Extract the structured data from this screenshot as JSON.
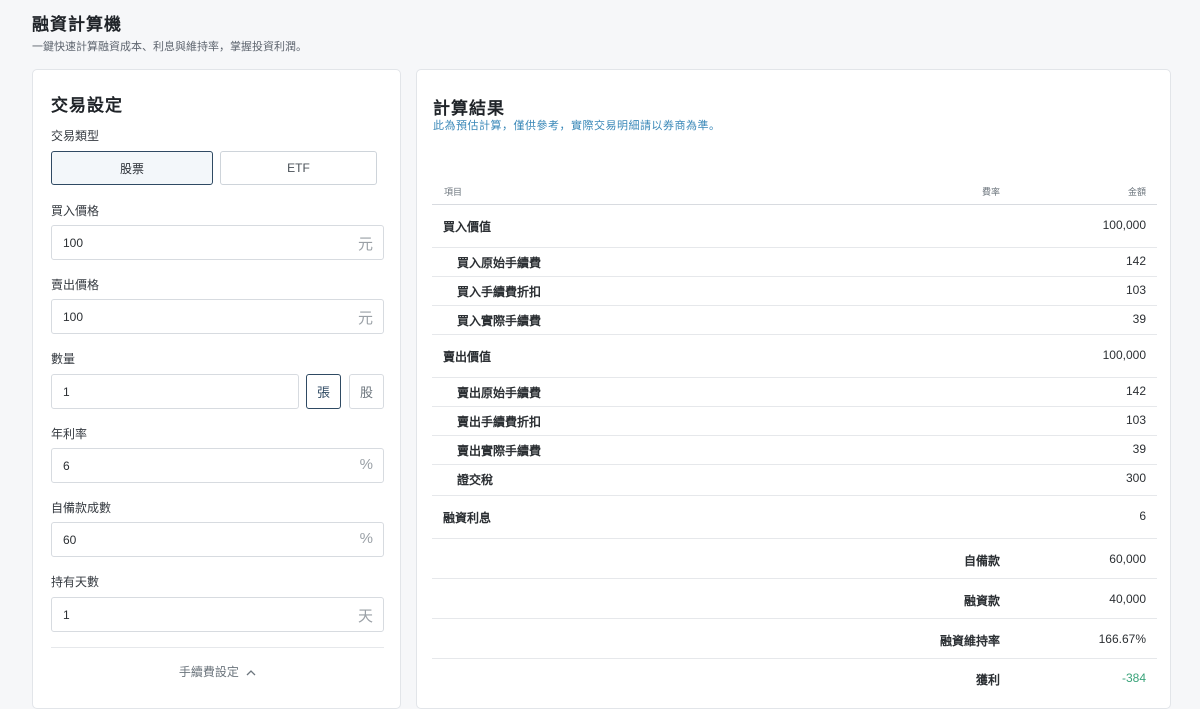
{
  "header": {
    "title": "融資計算機",
    "subtitle": "一鍵快速計算融資成本、利息與維持率，掌握投資利潤。"
  },
  "settings": {
    "title": "交易設定",
    "trade_type_label": "交易類型",
    "trade_types": [
      "股票",
      "ETF"
    ],
    "selected_trade_type": "股票",
    "buy_price": {
      "label": "買入價格",
      "value": "100",
      "unit": "元"
    },
    "sell_price": {
      "label": "賣出價格",
      "value": "100",
      "unit": "元"
    },
    "quantity": {
      "label": "數量",
      "value": "1",
      "units": [
        "張",
        "股"
      ],
      "selected_unit": "張"
    },
    "annual_rate": {
      "label": "年利率",
      "value": "6",
      "unit": "%"
    },
    "self_fund_ratio": {
      "label": "自備款成數",
      "value": "60",
      "unit": "%"
    },
    "holding_days": {
      "label": "持有天數",
      "value": "1",
      "unit": "天"
    },
    "fee_settings_label": "手續費設定",
    "fee_toggle_icon": "chevron-up-icon"
  },
  "results": {
    "title": "計算結果",
    "notice": "此為預估計算，僅供參考，實際交易明細請以券商為準。",
    "columns": {
      "item": "項目",
      "rate": "費率",
      "amount": "金額"
    },
    "rows": [
      {
        "name": "買入價值",
        "amount": "100,000"
      },
      {
        "name": "買入原始手續費",
        "amount": "142"
      },
      {
        "name": "買入手續費折扣",
        "amount": "103"
      },
      {
        "name": "買入實際手續費",
        "amount": "39"
      },
      {
        "name": "賣出價值",
        "amount": "100,000"
      },
      {
        "name": "賣出原始手續費",
        "amount": "142"
      },
      {
        "name": "賣出手續費折扣",
        "amount": "103"
      },
      {
        "name": "賣出實際手續費",
        "amount": "39"
      },
      {
        "name": "證交稅",
        "amount": "300"
      },
      {
        "name": "融資利息",
        "amount": "6"
      }
    ],
    "summary": [
      {
        "label": "自備款",
        "amount": "60,000"
      },
      {
        "label": "融資款",
        "amount": "40,000"
      },
      {
        "label": "融資維持率",
        "amount": "166.67%"
      },
      {
        "label": "獲利",
        "amount": "-384"
      }
    ],
    "colors": {
      "profit": "#3aa37a",
      "notice": "#3a88b8"
    }
  }
}
